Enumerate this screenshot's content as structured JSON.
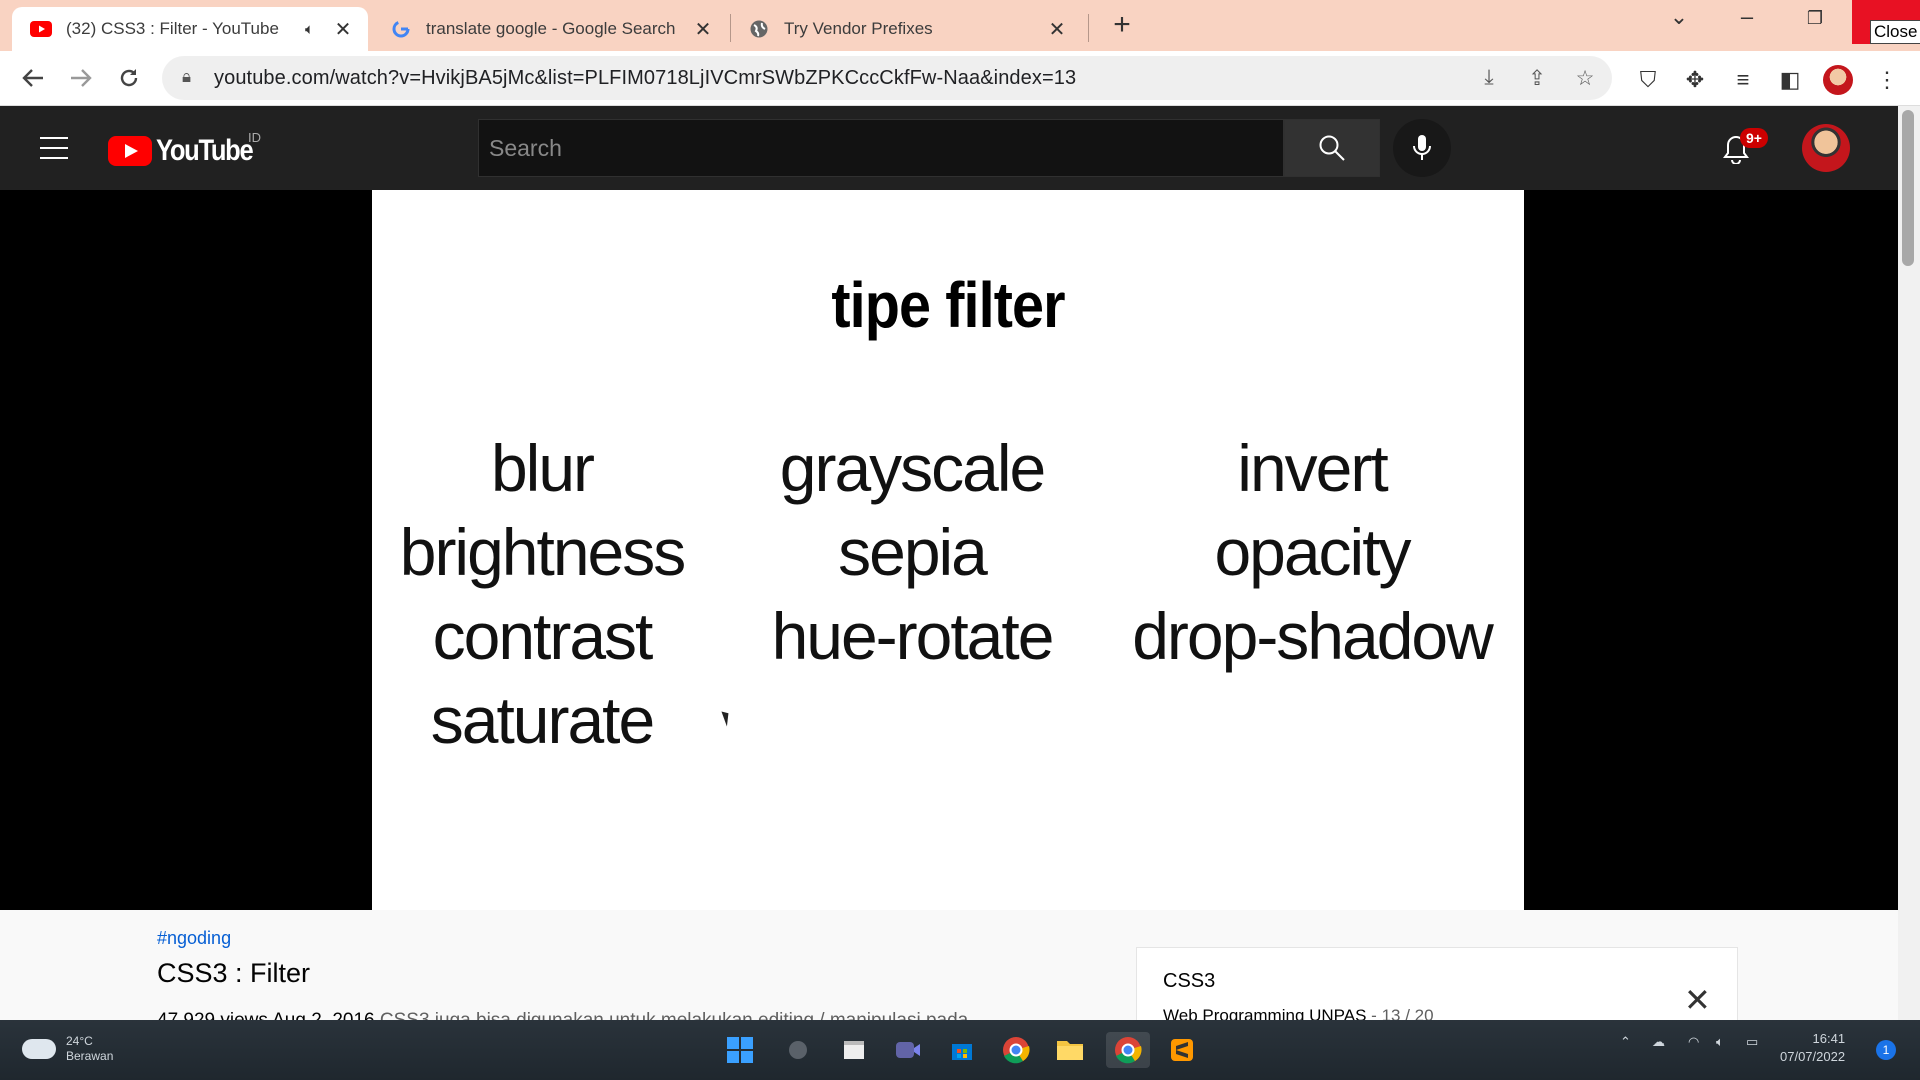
{
  "browser": {
    "tabs": [
      {
        "title": "(32) CSS3 : Filter - YouTube",
        "favicon": "youtube-icon",
        "audio": true,
        "active": true
      },
      {
        "title": "translate google - Google Search",
        "favicon": "google-icon",
        "audio": false,
        "active": false
      },
      {
        "title": "Try Vendor Prefixes",
        "favicon": "globe-icon",
        "audio": false,
        "active": false
      }
    ],
    "new_tab": "+",
    "close_tooltip": "Close",
    "url": "youtube.com/watch?v=HvikjBA5jMc&list=PLFIM0718LjIVCmrSWbZPKCccCkfFw-Naa&index=13",
    "colors": {
      "tabstrip": "#f9d3c2",
      "close": "#e81123"
    }
  },
  "youtube": {
    "logo_text": "YouTube",
    "country_code": "ID",
    "search_placeholder": "Search",
    "notification_badge": "9+",
    "colors": {
      "header": "#212121",
      "red": "#ff0000",
      "link": "#065fd4"
    }
  },
  "slide": {
    "title": "tipe filter",
    "words": [
      "blur",
      "grayscale",
      "invert",
      "brightness",
      "sepia",
      "opacity",
      "contrast",
      "hue-rotate",
      "drop-shadow",
      "saturate"
    ]
  },
  "video": {
    "hashtag": "#ngoding",
    "title": "CSS3 : Filter",
    "meta": "47,929 views  Aug 2, 2016",
    "description": "CSS3 juga bisa digunakan untuk melakukan editing / manipulasi pada"
  },
  "playlist": {
    "name": "CSS3",
    "channel": "Web Programming UNPAS",
    "position": "13 / 20"
  },
  "taskbar": {
    "weather_temp": "24°C",
    "weather_desc": "Berawan",
    "time": "16:41",
    "date": "07/07/2022",
    "notification_count": "1"
  }
}
